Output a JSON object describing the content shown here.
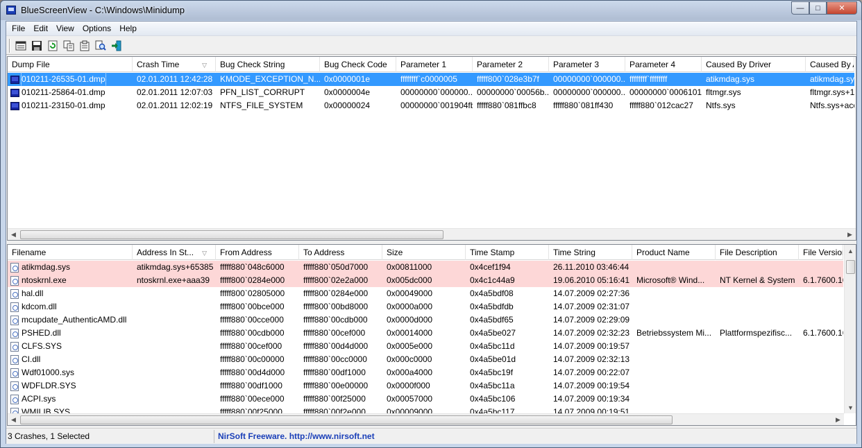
{
  "window": {
    "title": "BlueScreenView  -  C:\\Windows\\Minidump"
  },
  "menu": [
    {
      "label": "File"
    },
    {
      "label": "Edit"
    },
    {
      "label": "View"
    },
    {
      "label": "Options"
    },
    {
      "label": "Help"
    }
  ],
  "toolbar": {
    "icons": [
      "save-html-icon",
      "save-icon",
      "refresh-icon",
      "copy-icon",
      "properties-icon",
      "find-icon",
      "exit-icon"
    ]
  },
  "crash_list": {
    "columns": [
      "Dump File",
      "Crash Time",
      "Bug Check String",
      "Bug Check Code",
      "Parameter 1",
      "Parameter 2",
      "Parameter 3",
      "Parameter 4",
      "Caused By Driver",
      "Caused By Ad"
    ],
    "sorted_column": "Crash Time",
    "rows": [
      {
        "selected": true,
        "cells": [
          "010211-26535-01.dmp",
          "02.01.2011 12:42:28",
          "KMODE_EXCEPTION_N...",
          "0x0000001e",
          "ffffffff`c0000005",
          "fffff800`028e3b7f",
          "00000000`000000...",
          "ffffffff`ffffffff",
          "atikmdag.sys",
          "atikmdag.sys+"
        ]
      },
      {
        "selected": false,
        "cells": [
          "010211-25864-01.dmp",
          "02.01.2011 12:07:03",
          "PFN_LIST_CORRUPT",
          "0x0000004e",
          "00000000`000000...",
          "00000000`00056b...",
          "00000000`000000...",
          "00000000`0006101f",
          "fltmgr.sys",
          "fltmgr.sys+1b"
        ]
      },
      {
        "selected": false,
        "cells": [
          "010211-23150-01.dmp",
          "02.01.2011 12:02:19",
          "NTFS_FILE_SYSTEM",
          "0x00000024",
          "00000000`001904fb",
          "fffff880`081ffbc8",
          "fffff880`081ff430",
          "fffff880`012cac27",
          "Ntfs.sys",
          "Ntfs.sys+acc"
        ]
      }
    ]
  },
  "driver_list": {
    "columns": [
      "Filename",
      "Address In St...",
      "From Address",
      "To Address",
      "Size",
      "Time Stamp",
      "Time String",
      "Product Name",
      "File Description",
      "File Version"
    ],
    "sorted_column": "Address In St...",
    "rows": [
      {
        "highlight": true,
        "cells": [
          "atikmdag.sys",
          "atikmdag.sys+65385",
          "fffff880`048c6000",
          "fffff880`050d7000",
          "0x00811000",
          "0x4cef1f94",
          "26.11.2010 03:46:44",
          "",
          "",
          ""
        ]
      },
      {
        "highlight": true,
        "cells": [
          "ntoskrnl.exe",
          "ntoskrnl.exe+aaa39",
          "fffff800`0284e000",
          "fffff800`02e2a000",
          "0x005dc000",
          "0x4c1c44a9",
          "19.06.2010 05:16:41",
          "Microsoft® Wind...",
          "NT Kernel & System",
          "6.1.7600.166"
        ]
      },
      {
        "highlight": false,
        "cells": [
          "hal.dll",
          "",
          "fffff800`02805000",
          "fffff800`0284e000",
          "0x00049000",
          "0x4a5bdf08",
          "14.07.2009 02:27:36",
          "",
          "",
          ""
        ]
      },
      {
        "highlight": false,
        "cells": [
          "kdcom.dll",
          "",
          "fffff800`00bce000",
          "fffff800`00bd8000",
          "0x0000a000",
          "0x4a5bdfdb",
          "14.07.2009 02:31:07",
          "",
          "",
          ""
        ]
      },
      {
        "highlight": false,
        "cells": [
          "mcupdate_AuthenticAMD.dll",
          "",
          "fffff880`00cce000",
          "fffff880`00cdb000",
          "0x0000d000",
          "0x4a5bdf65",
          "14.07.2009 02:29:09",
          "",
          "",
          ""
        ]
      },
      {
        "highlight": false,
        "cells": [
          "PSHED.dll",
          "",
          "fffff880`00cdb000",
          "fffff880`00cef000",
          "0x00014000",
          "0x4a5be027",
          "14.07.2009 02:32:23",
          "Betriebssystem Mi...",
          "Plattformspezifisc...",
          "6.1.7600.163"
        ]
      },
      {
        "highlight": false,
        "cells": [
          "CLFS.SYS",
          "",
          "fffff880`00cef000",
          "fffff880`00d4d000",
          "0x0005e000",
          "0x4a5bc11d",
          "14.07.2009 00:19:57",
          "",
          "",
          ""
        ]
      },
      {
        "highlight": false,
        "cells": [
          "CI.dll",
          "",
          "fffff880`00c00000",
          "fffff880`00cc0000",
          "0x000c0000",
          "0x4a5be01d",
          "14.07.2009 02:32:13",
          "",
          "",
          ""
        ]
      },
      {
        "highlight": false,
        "cells": [
          "Wdf01000.sys",
          "",
          "fffff880`00d4d000",
          "fffff880`00df1000",
          "0x000a4000",
          "0x4a5bc19f",
          "14.07.2009 00:22:07",
          "",
          "",
          ""
        ]
      },
      {
        "highlight": false,
        "cells": [
          "WDFLDR.SYS",
          "",
          "fffff880`00df1000",
          "fffff880`00e00000",
          "0x0000f000",
          "0x4a5bc11a",
          "14.07.2009 00:19:54",
          "",
          "",
          ""
        ]
      },
      {
        "highlight": false,
        "cells": [
          "ACPI.sys",
          "",
          "fffff880`00ece000",
          "fffff880`00f25000",
          "0x00057000",
          "0x4a5bc106",
          "14.07.2009 00:19:34",
          "",
          "",
          ""
        ]
      },
      {
        "highlight": false,
        "cells": [
          "WMILIB.SYS",
          "",
          "fffff880`00f25000",
          "fffff880`00f2e000",
          "0x00009000",
          "0x4a5bc117",
          "14.07.2009 00:19:51",
          "",
          "",
          ""
        ]
      }
    ]
  },
  "status": {
    "summary": "3 Crashes, 1 Selected",
    "link": "NirSoft Freeware.  http://www.nirsoft.net",
    "link_color": "#1a3fb8"
  },
  "colors": {
    "selection": "#3399ff",
    "highlight_row": "#fdd7d7"
  }
}
